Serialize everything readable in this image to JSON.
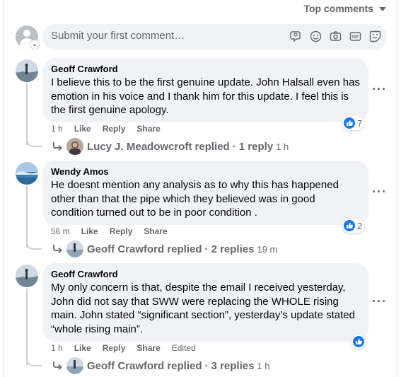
{
  "header": {
    "sort_label": "Top comments"
  },
  "composer": {
    "placeholder": "Submit your first comment…"
  },
  "comments": [
    {
      "author": "Geoff Crawford",
      "text": "I believe this to be the first genuine update. John Halsall even has emotion in his voice and I thank him for this update. I feel this is the first genuine apology.",
      "time": "1 h",
      "like": "Like",
      "reply": "Reply",
      "share": "Share",
      "reaction_count": "7",
      "replies": {
        "name": "Lucy J. Meadowcroft replied",
        "count": "· 1 reply",
        "time": "1 h"
      }
    },
    {
      "author": "Wendy Amos",
      "text": "He doesnt mention any analysis as to why this has happened other than that the pipe which they believed was in good condition turned out to be in poor condition .",
      "time": "56 m",
      "like": "Like",
      "reply": "Reply",
      "share": "Share",
      "reaction_count": "2",
      "replies": {
        "name": "Geoff Crawford replied",
        "count": "· 2 replies",
        "time": "19 m"
      }
    },
    {
      "author": "Geoff Crawford",
      "text": "My only concern is that, despite the email I received yesterday, John did not say that SWW were replacing the WHOLE rising main. John stated “significant section”, yesterday’s update stated “whole rising main”.",
      "time": "1 h",
      "like": "Like",
      "reply": "Reply",
      "share": "Share",
      "edited": "Edited",
      "replies": {
        "name": "Geoff Crawford replied",
        "count": "· 3 replies",
        "time": "1 h"
      }
    }
  ],
  "colors": {
    "accent": "#1877f2",
    "muted": "#65676b",
    "bubble": "#f0f2f5"
  }
}
